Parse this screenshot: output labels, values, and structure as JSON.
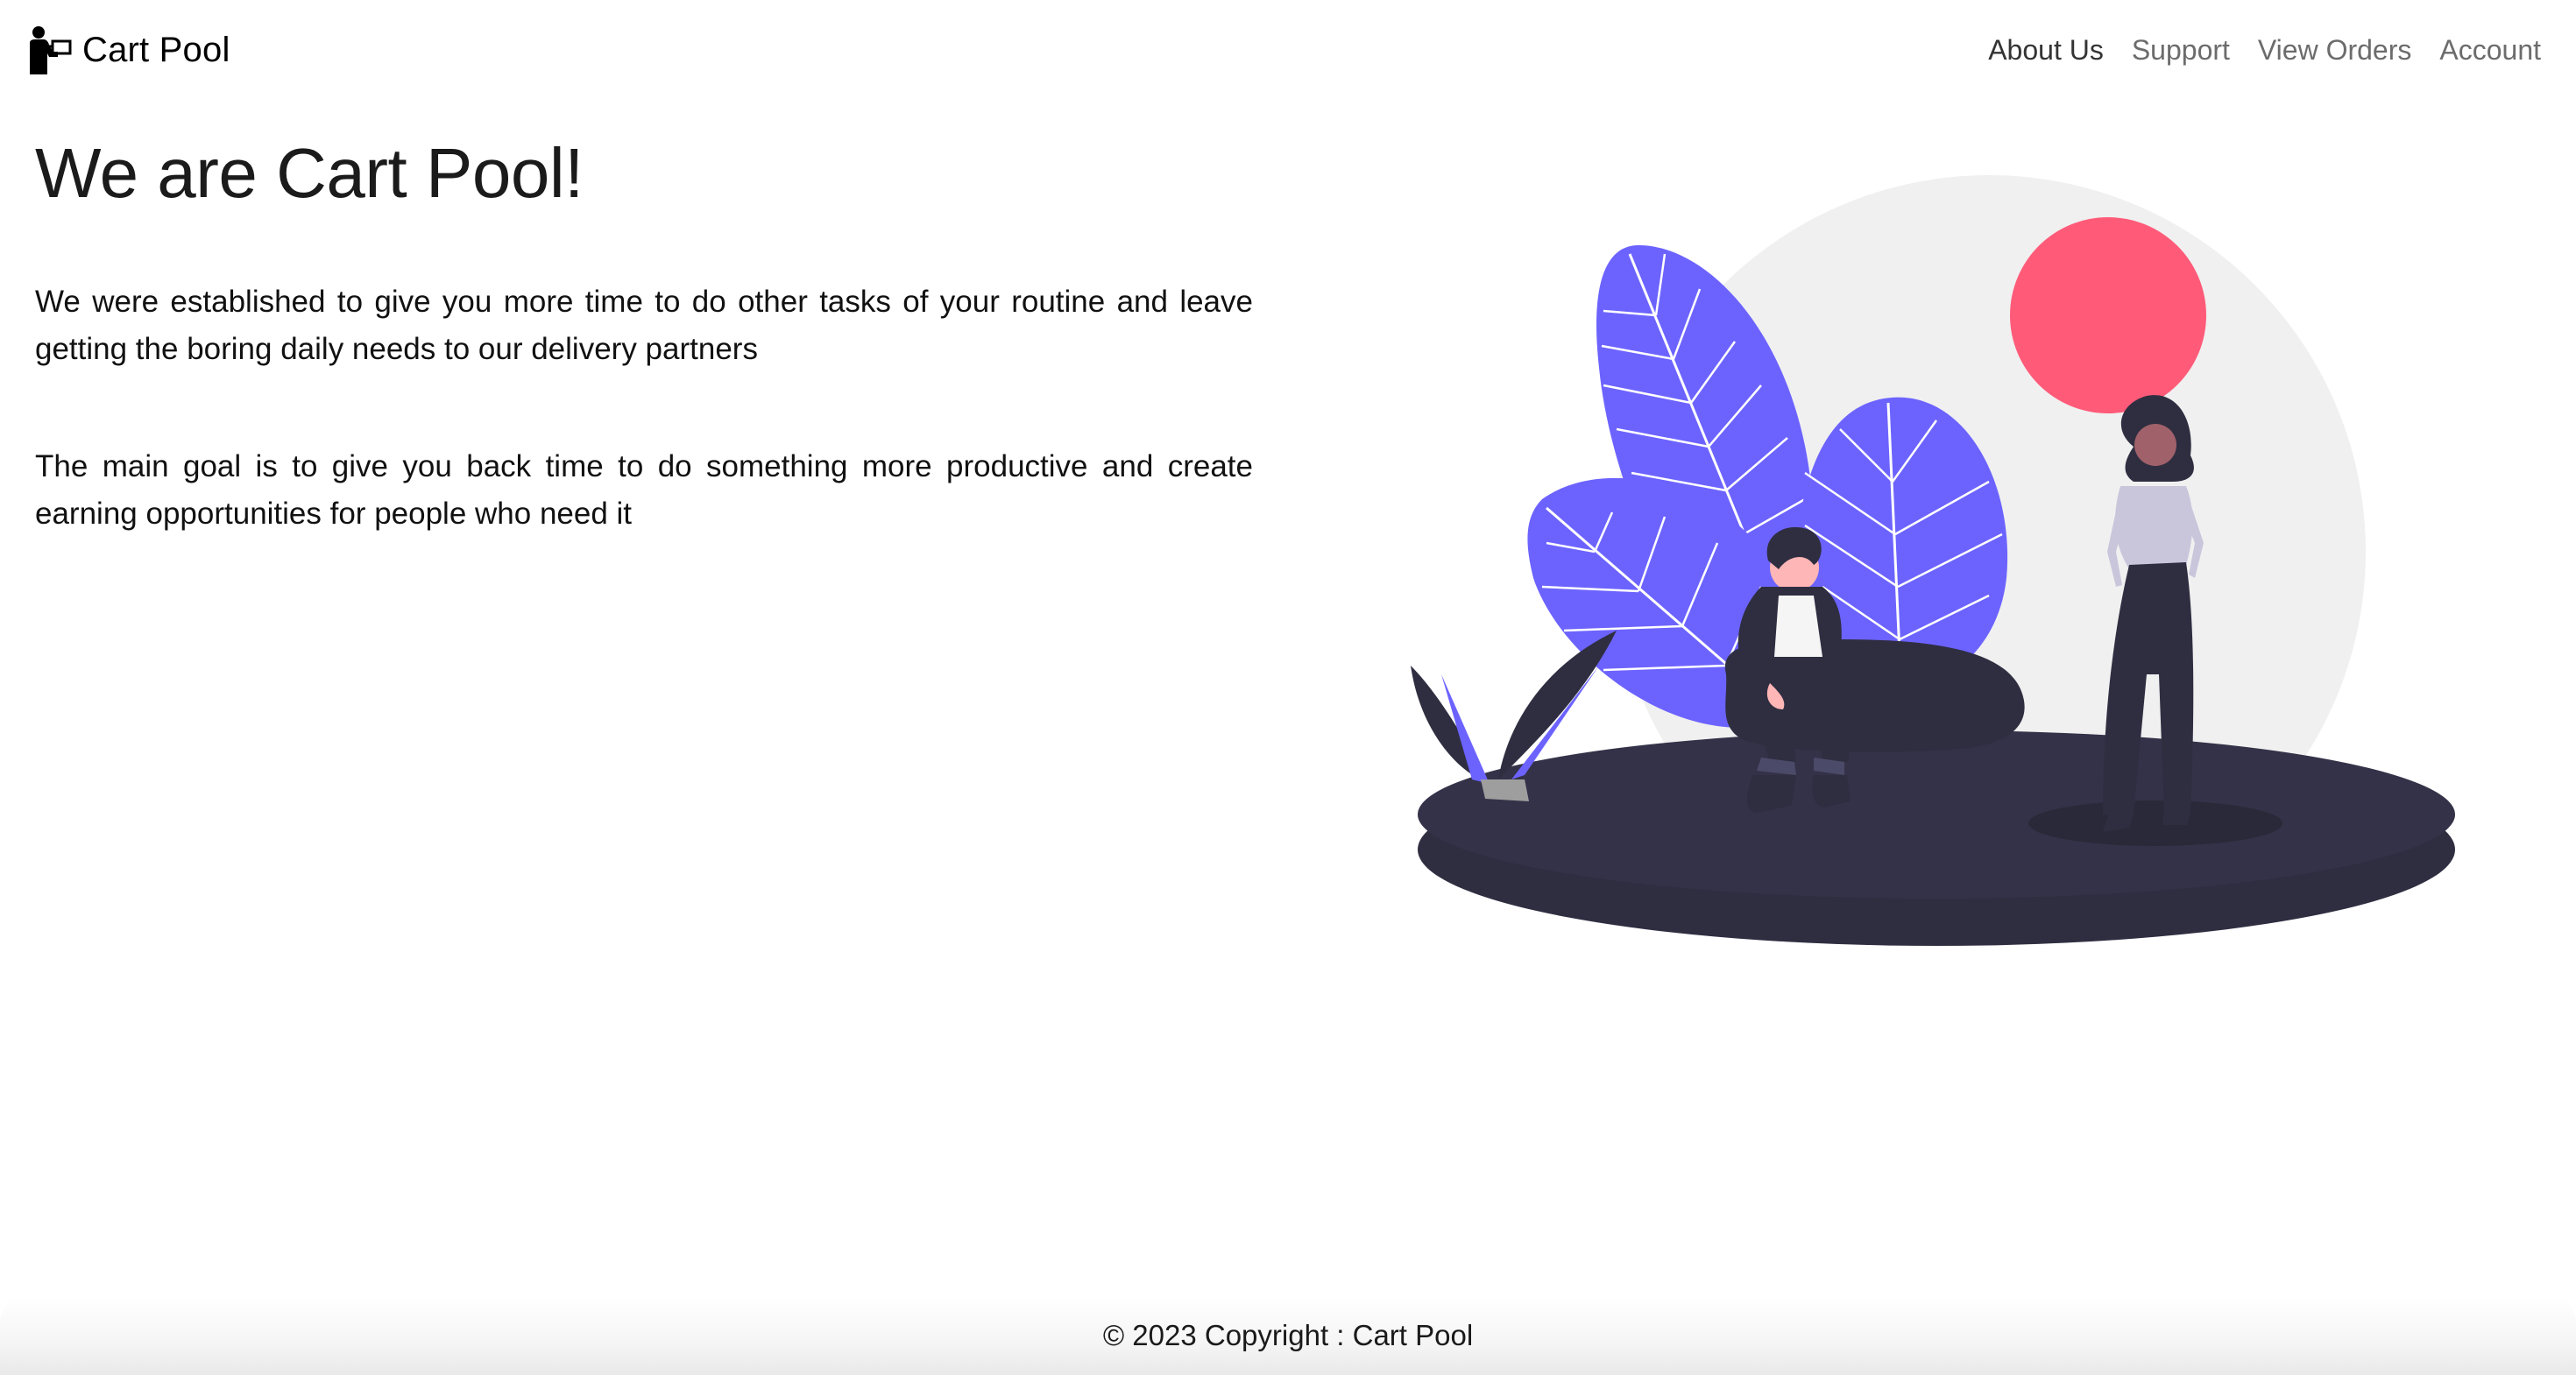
{
  "navbar": {
    "brand": "Cart Pool",
    "brand_icon": "person-with-cart-icon",
    "links": [
      {
        "label": "About Us",
        "active": true
      },
      {
        "label": "Support",
        "active": false
      },
      {
        "label": "View Orders",
        "active": false
      },
      {
        "label": "Account",
        "active": false
      }
    ]
  },
  "main": {
    "title": "We are Cart Pool!",
    "paragraphs": [
      "We were established to give you more time to do other tasks of your routine and leave getting the boring daily needs to our delivery partners",
      "The main goal is to give you back time to do something more productive and create earning opportunities for people who need it"
    ]
  },
  "footer": {
    "text": "© 2023 Copyright : Cart Pool"
  },
  "colors": {
    "accent_purple": "#6c63ff",
    "accent_pink": "#ff5b79",
    "dark": "#2f2e41"
  }
}
